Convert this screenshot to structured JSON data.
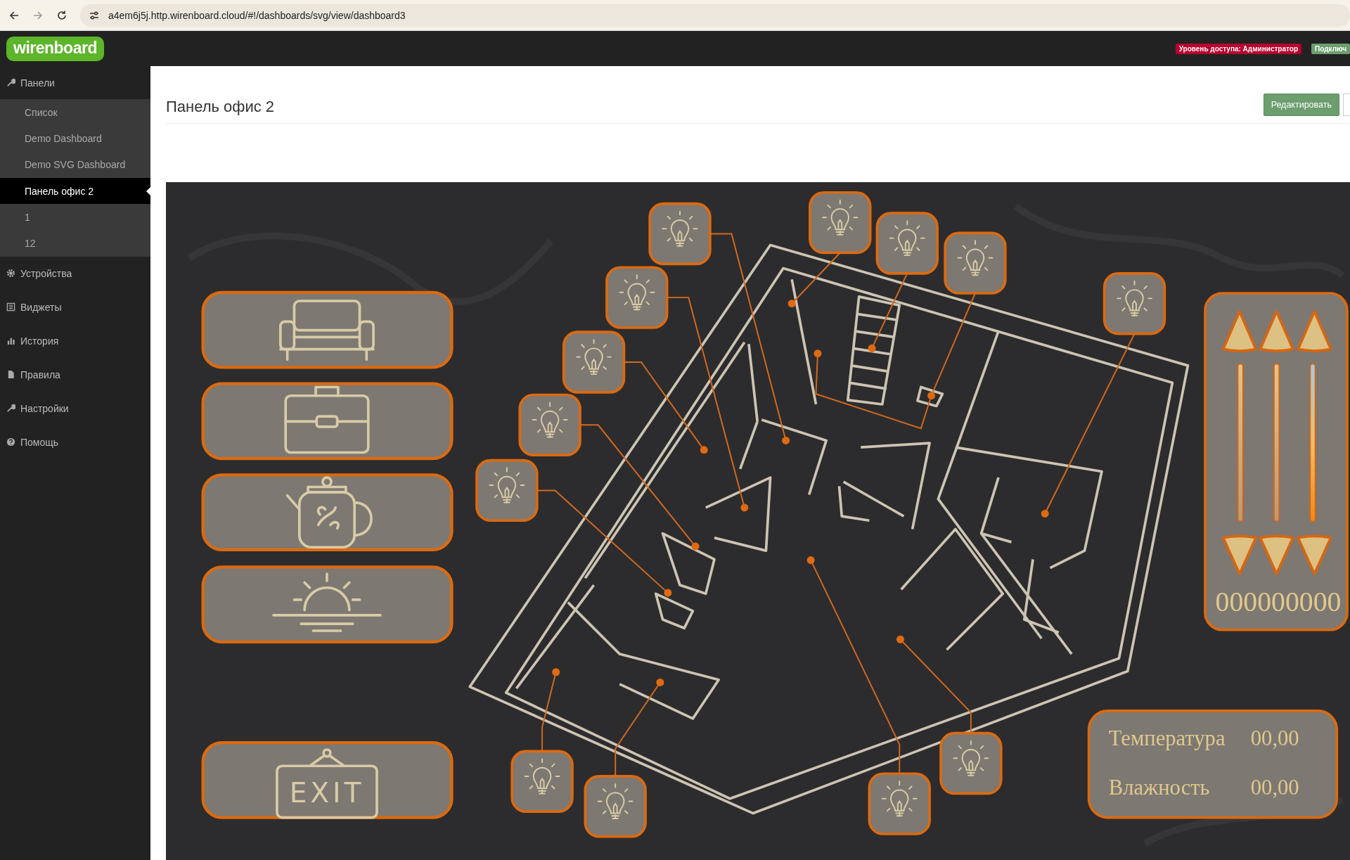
{
  "browser": {
    "url": "a4em6j5j.http.wirenboard.cloud/#!/dashboards/svg/view/dashboard3"
  },
  "navbar": {
    "logo": "wirenboard",
    "badges": [
      {
        "label": "Уровень доступа: Администратор",
        "kind": "access"
      },
      {
        "label": "Подключ",
        "kind": "connection"
      }
    ]
  },
  "sidebar": {
    "items": [
      {
        "label": "Панели",
        "expanded": true,
        "children": [
          {
            "label": "Список",
            "selected": false
          },
          {
            "label": "Demo Dashboard",
            "selected": false
          },
          {
            "label": "Demo SVG Dashboard",
            "selected": false
          },
          {
            "label": "Панель офис 2",
            "selected": true
          },
          {
            "label": "1",
            "selected": false
          },
          {
            "label": "12",
            "selected": false
          }
        ]
      },
      {
        "label": "Устройства",
        "expanded": false
      },
      {
        "label": "Виджеты",
        "expanded": false
      },
      {
        "label": "История",
        "expanded": false
      },
      {
        "label": "Правила",
        "expanded": false
      },
      {
        "label": "Настройки",
        "expanded": false
      },
      {
        "label": "Помощь",
        "expanded": false
      }
    ]
  },
  "page": {
    "title": "Панель офис 2",
    "edit_button": "Редактировать"
  },
  "dashboard": {
    "buttons": [
      {
        "kind": "sofa"
      },
      {
        "kind": "briefcase"
      },
      {
        "kind": "teapot"
      },
      {
        "kind": "sunrise"
      },
      {
        "kind": "exit",
        "label": "EXIT"
      }
    ],
    "counter": "000000000",
    "climate": [
      {
        "label": "Температура",
        "value": "00,00"
      },
      {
        "label": "Влажность",
        "value": "00,00"
      }
    ]
  }
}
